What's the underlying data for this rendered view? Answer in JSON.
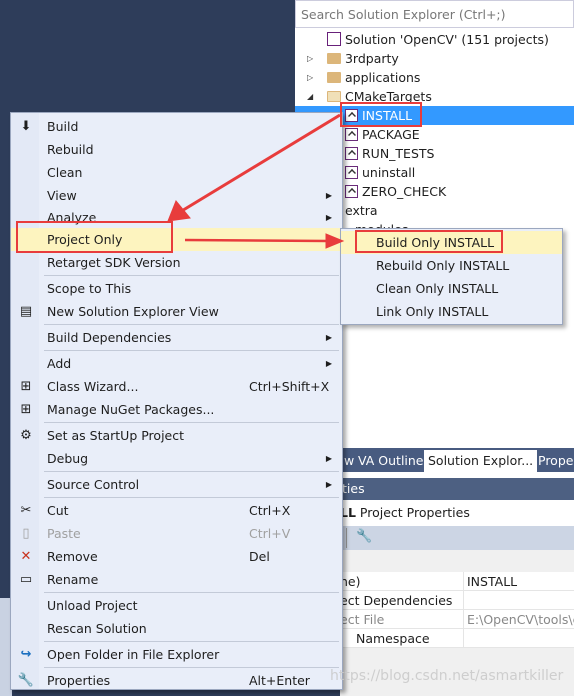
{
  "solution_explorer": {
    "search_placeholder": "Search Solution Explorer (Ctrl+;)",
    "solution": "Solution 'OpenCV' (151 projects)",
    "folders": [
      "3rdparty",
      "applications",
      "CMakeTargets"
    ],
    "projects": [
      "INSTALL",
      "PACKAGE",
      "RUN_TESTS",
      "uninstall",
      "ZERO_CHECK"
    ],
    "extra": "extra",
    "partial": "modules"
  },
  "tabs": [
    "w",
    "VA Outline",
    "Solution Explor...",
    "Proper"
  ],
  "properties": {
    "header": "ties",
    "title_bold": "LL",
    "title": "Project Properties",
    "rows": [
      {
        "name": "ne)",
        "value": "INSTALL"
      },
      {
        "name": "ect Dependencies",
        "value": ""
      },
      {
        "name": "ect File",
        "value": "E:\\OpenCV\\tools\\c"
      },
      {
        "name": "Namespace",
        "value": ""
      }
    ]
  },
  "context_menu": {
    "build": "Build",
    "rebuild": "Rebuild",
    "clean": "Clean",
    "view": "View",
    "analyze": "Analyze",
    "project_only": "Project Only",
    "retarget": "Retarget SDK Version",
    "scope": "Scope to This",
    "new_view": "New Solution Explorer View",
    "build_deps": "Build Dependencies",
    "add": "Add",
    "class_wizard": "Class Wizard...",
    "class_wizard_sc": "Ctrl+Shift+X",
    "nuget": "Manage NuGet Packages...",
    "startup": "Set as StartUp Project",
    "debug": "Debug",
    "source_control": "Source Control",
    "cut": "Cut",
    "cut_sc": "Ctrl+X",
    "paste": "Paste",
    "paste_sc": "Ctrl+V",
    "remove": "Remove",
    "remove_sc": "Del",
    "rename": "Rename",
    "unload": "Unload Project",
    "rescan": "Rescan Solution",
    "open_folder": "Open Folder in File Explorer",
    "properties": "Properties",
    "properties_sc": "Alt+Enter"
  },
  "submenu": [
    "Build Only INSTALL",
    "Rebuild Only INSTALL",
    "Clean Only INSTALL",
    "Link Only INSTALL"
  ],
  "watermark": "https://blog.csdn.net/asmartkiller",
  "colors": {
    "selection": "#3399ff",
    "highlight": "#fdf4bf",
    "annotation": "#e83c3c",
    "menu_bg": "#e9eef9"
  }
}
